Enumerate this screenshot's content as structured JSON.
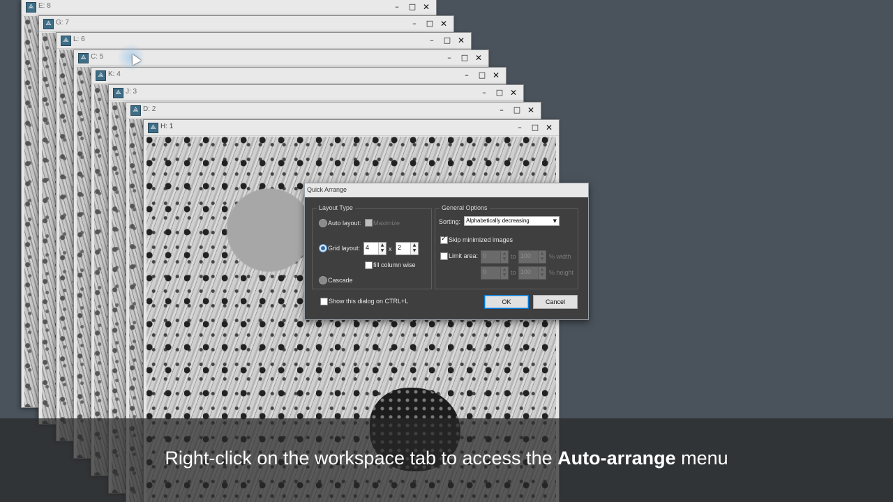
{
  "windows": [
    {
      "title": "E: 8"
    },
    {
      "title": "G: 7"
    },
    {
      "title": "L: 6"
    },
    {
      "title": "C: 5"
    },
    {
      "title": "K: 4"
    },
    {
      "title": "J: 3"
    },
    {
      "title": "D: 2"
    },
    {
      "title": "H: 1"
    }
  ],
  "window_controls": {
    "minimize": "–",
    "maximize": "□",
    "close": "✕"
  },
  "dialog": {
    "title": "Quick Arrange",
    "layout_type": {
      "label": "Layout Type",
      "auto_layout": "Auto layout:",
      "maximize": "Maximize",
      "grid_layout": "Grid layout:",
      "grid_cols": "4",
      "grid_x": "x",
      "grid_rows": "2",
      "fill_column_wise": "fill column wise",
      "cascade": "Cascade",
      "selected": "Grid layout"
    },
    "general_options": {
      "label": "General Options",
      "sorting_label": "Sorting:",
      "sorting_value": "Alphabetically decreasing",
      "skip_minimized": "Skip minimized images",
      "skip_minimized_checked": true,
      "limit_area": "Limit area:",
      "limit_area_checked": false,
      "width_from": "0",
      "width_to": "100",
      "to_label": "to",
      "width_unit": "% width",
      "height_from": "0",
      "height_to": "100",
      "height_unit": "% height"
    },
    "show_on_ctrl_l": "Show this dialog on CTRL+L",
    "ok": "OK",
    "cancel": "Cancel"
  },
  "caption": {
    "before": "Right-click on the workspace tab to access the ",
    "bold": "Auto-arrange",
    "after": " menu"
  },
  "icons": {
    "app": "image-window-icon",
    "cursor": "mouse-pointer-icon",
    "spinner": "up-down-arrows-icon"
  }
}
